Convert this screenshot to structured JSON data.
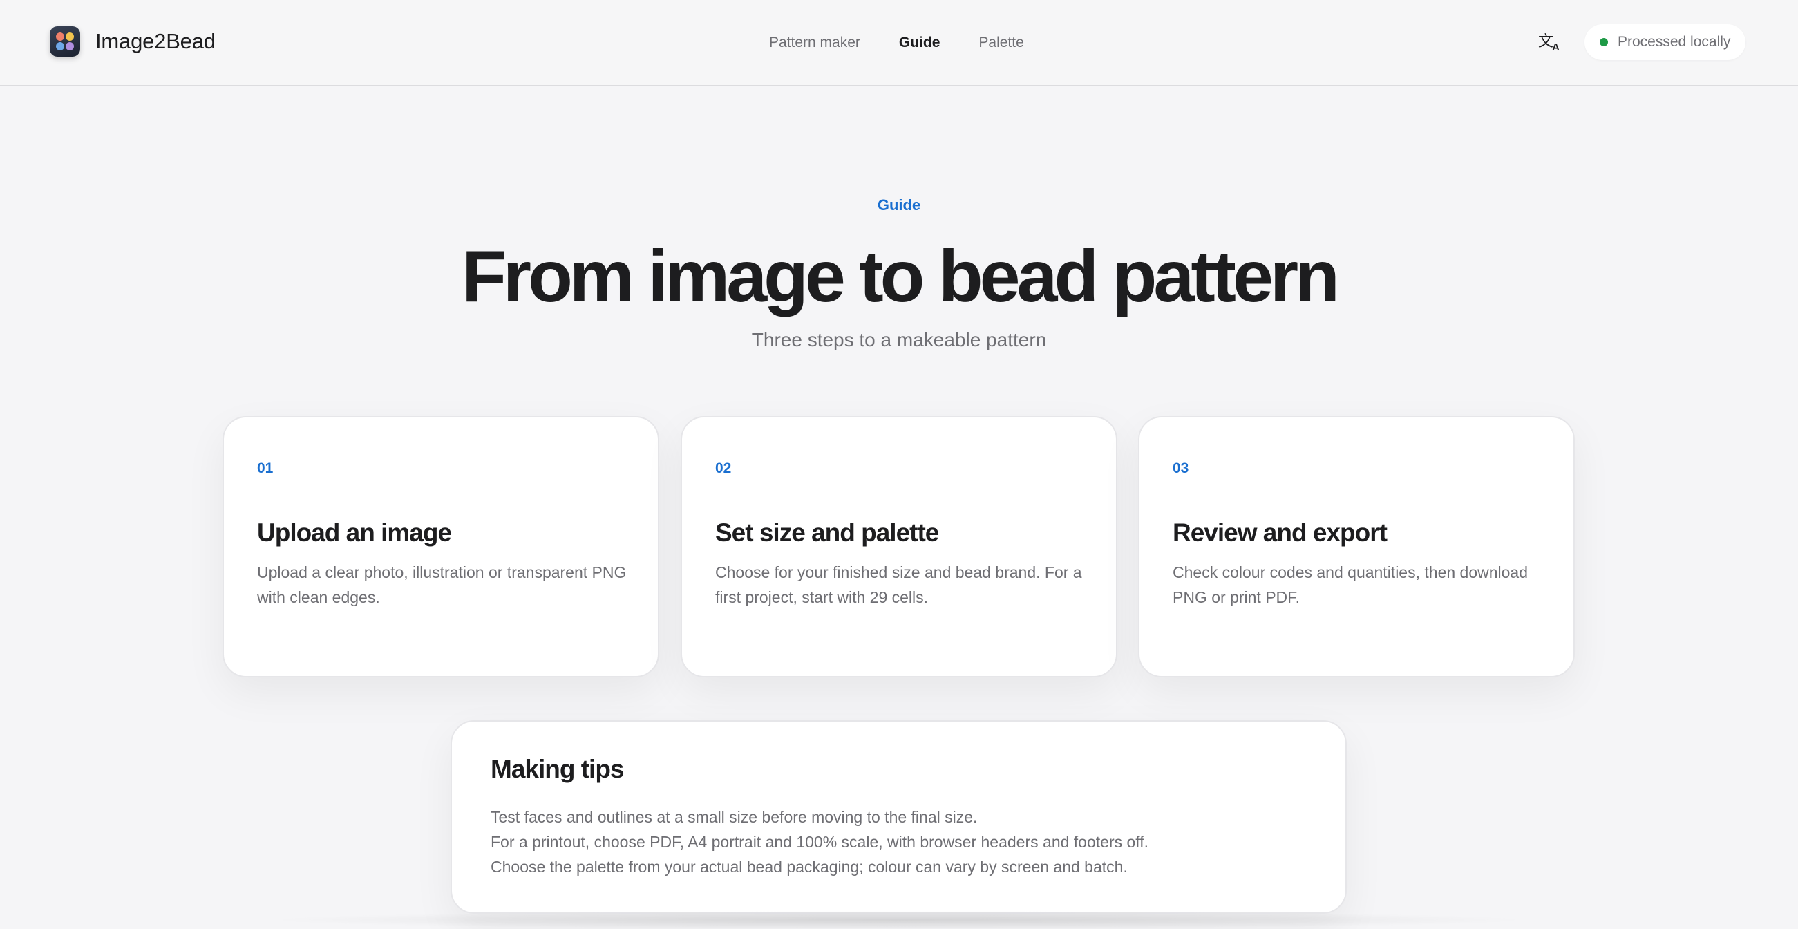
{
  "header": {
    "brand_name": "Image2Bead",
    "nav": [
      {
        "label": "Pattern maker",
        "active": false
      },
      {
        "label": "Guide",
        "active": true
      },
      {
        "label": "Palette",
        "active": false
      }
    ],
    "language_icon": "translate-icon",
    "language_glyph_main": "文",
    "language_glyph_sub": "A",
    "status": {
      "label": "Processed locally",
      "color": "#1e9a46"
    }
  },
  "hero": {
    "eyebrow": "Guide",
    "title": "From image to bead pattern",
    "subtitle": "Three steps to a makeable pattern"
  },
  "steps": [
    {
      "number": "01",
      "title": "Upload an image",
      "body": "Upload a clear photo, illustration or transparent PNG with clean edges."
    },
    {
      "number": "02",
      "title": "Set size and palette",
      "body": "Choose for your finished size and bead brand. For a first project, start with 29 cells."
    },
    {
      "number": "03",
      "title": "Review and export",
      "body": "Check colour codes and quantities, then download PNG or print PDF."
    }
  ],
  "tips": {
    "title": "Making tips",
    "items": [
      "Test faces and outlines at a small size before moving to the final size.",
      "For a printout, choose PDF, A4 portrait and 100% scale, with browser headers and footers off.",
      "Choose the palette from your actual bead packaging; colour can vary by screen and batch."
    ]
  },
  "colors": {
    "accent": "#1a6fd0",
    "text": "#1d1d1f",
    "muted": "#6e6e73",
    "background": "#f5f5f7"
  }
}
